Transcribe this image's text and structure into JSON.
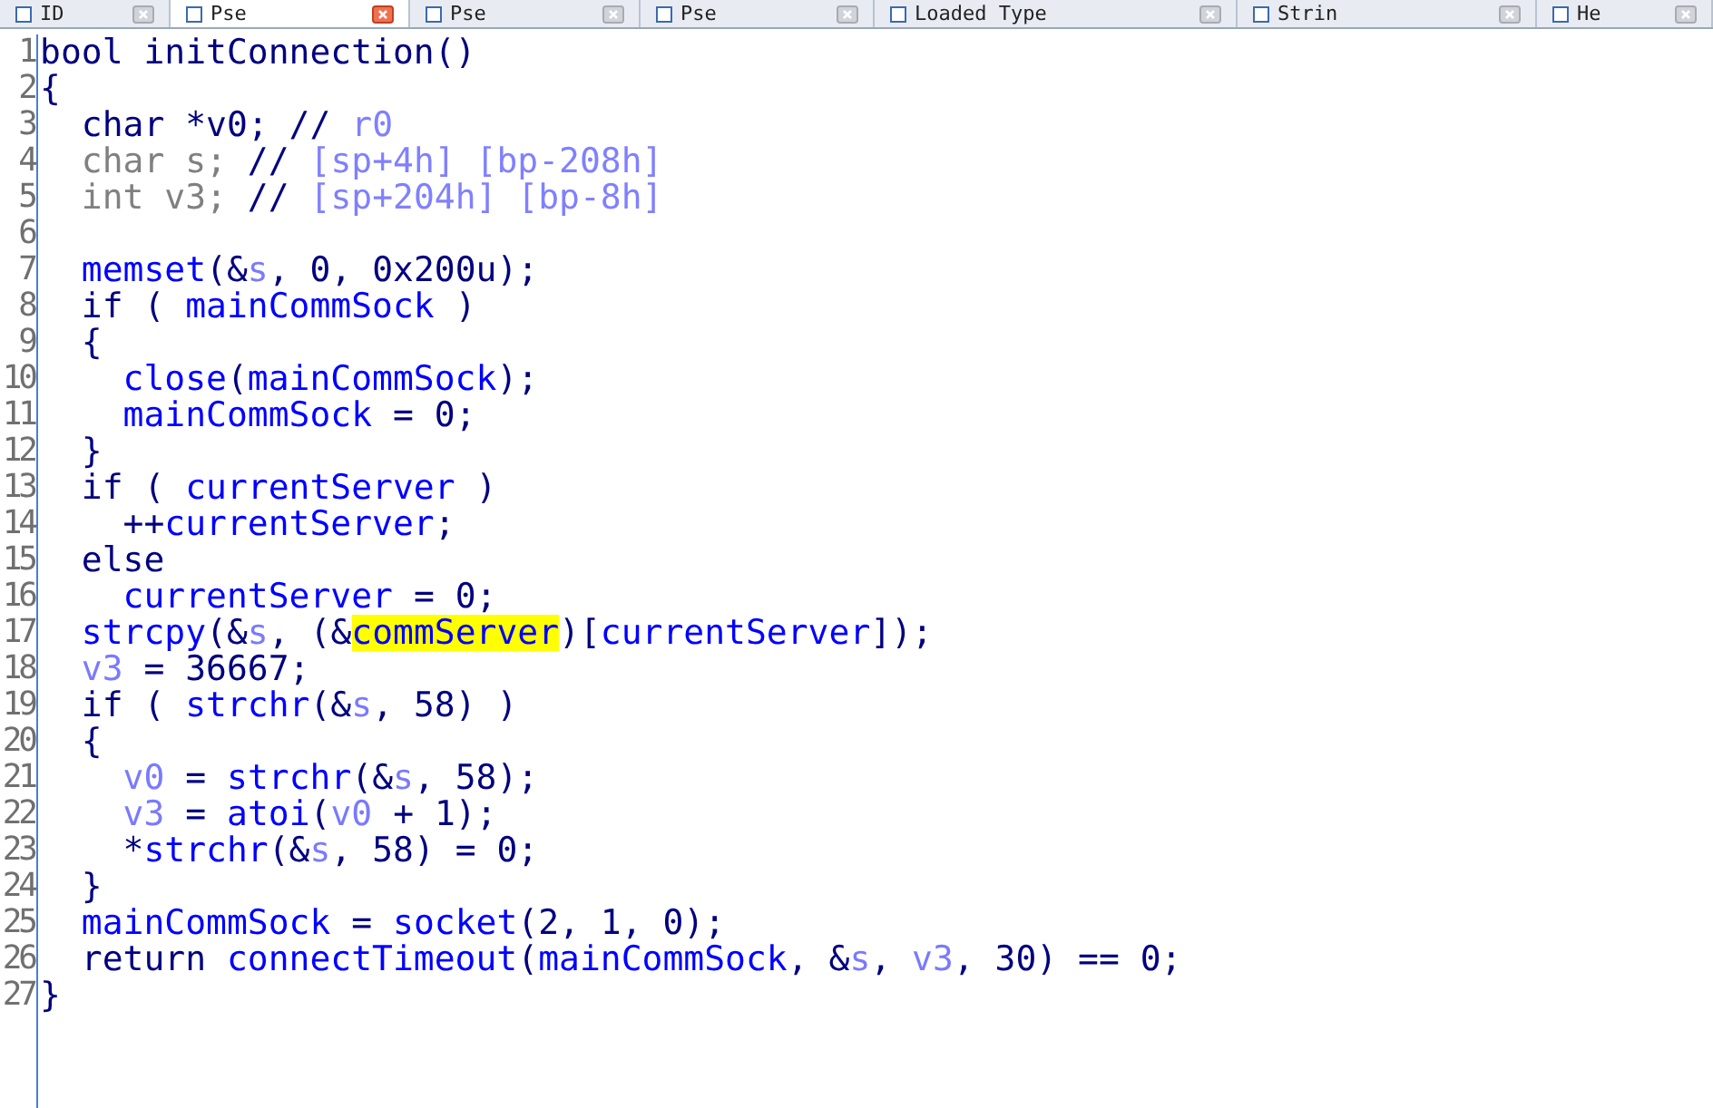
{
  "tabs": [
    {
      "label": "ID",
      "selected": false
    },
    {
      "label": "Pse",
      "selected": true
    },
    {
      "label": "Pse",
      "selected": false
    },
    {
      "label": "Pse",
      "selected": false
    },
    {
      "label": "Loaded Type",
      "selected": false
    },
    {
      "label": "Strin",
      "selected": false
    },
    {
      "label": "He",
      "selected": false
    }
  ],
  "code_lines": [
    {
      "number": "1",
      "tokens": [
        {
          "text": "bool initConnection()",
          "kind": "plain"
        }
      ]
    },
    {
      "number": "2",
      "tokens": [
        {
          "text": "{",
          "kind": "plain"
        }
      ]
    },
    {
      "number": "3",
      "tokens": [
        {
          "text": "  char *v0; //",
          "kind": "plain"
        },
        {
          "text": " r0",
          "kind": "comment"
        }
      ]
    },
    {
      "number": "4",
      "tokens": [
        {
          "text": "  char s; ",
          "kind": "disabled"
        },
        {
          "text": "//",
          "kind": "plain"
        },
        {
          "text": " [sp+4h] [bp-208h]",
          "kind": "comment"
        }
      ]
    },
    {
      "number": "5",
      "tokens": [
        {
          "text": "  int v3; ",
          "kind": "disabled"
        },
        {
          "text": "//",
          "kind": "plain"
        },
        {
          "text": " [sp+204h] [bp-8h]",
          "kind": "comment"
        }
      ]
    },
    {
      "number": "6"
    },
    {
      "number": "7",
      "tokens": [
        {
          "text": "  memset",
          "kind": "global"
        },
        {
          "text": "(&",
          "kind": "plain"
        },
        {
          "text": "s",
          "kind": "local"
        },
        {
          "text": ", 0, 0x200u);",
          "kind": "plain"
        }
      ]
    },
    {
      "number": "8",
      "tokens": [
        {
          "text": "  if ( ",
          "kind": "plain"
        },
        {
          "text": "mainCommSock",
          "kind": "global"
        },
        {
          "text": " )",
          "kind": "plain"
        }
      ]
    },
    {
      "number": "9",
      "tokens": [
        {
          "text": "  {",
          "kind": "plain"
        }
      ]
    },
    {
      "number": "10",
      "tokens": [
        {
          "text": "    close",
          "kind": "global"
        },
        {
          "text": "(",
          "kind": "plain"
        },
        {
          "text": "mainCommSock",
          "kind": "global"
        },
        {
          "text": ");",
          "kind": "plain"
        }
      ]
    },
    {
      "number": "11",
      "tokens": [
        {
          "text": "    mainCommSock",
          "kind": "global"
        },
        {
          "text": " = 0;",
          "kind": "plain"
        }
      ]
    },
    {
      "number": "12",
      "tokens": [
        {
          "text": "  }",
          "kind": "plain"
        }
      ]
    },
    {
      "number": "13",
      "tokens": [
        {
          "text": "  if ( ",
          "kind": "plain"
        },
        {
          "text": "currentServer",
          "kind": "global"
        },
        {
          "text": " )",
          "kind": "plain"
        }
      ]
    },
    {
      "number": "14",
      "tokens": [
        {
          "text": "    ++",
          "kind": "plain"
        },
        {
          "text": "currentServer",
          "kind": "global"
        },
        {
          "text": ";",
          "kind": "plain"
        }
      ]
    },
    {
      "number": "15",
      "tokens": [
        {
          "text": "  else",
          "kind": "plain"
        }
      ]
    },
    {
      "number": "16",
      "tokens": [
        {
          "text": "    currentServer",
          "kind": "global"
        },
        {
          "text": " = 0;",
          "kind": "plain"
        }
      ]
    },
    {
      "number": "17",
      "tokens": [
        {
          "text": "  strcpy",
          "kind": "global"
        },
        {
          "text": "(&",
          "kind": "plain"
        },
        {
          "text": "s",
          "kind": "local"
        },
        {
          "text": ", (&",
          "kind": "plain"
        },
        {
          "text": "commServer",
          "kind": "highlight"
        },
        {
          "text": ")[",
          "kind": "plain"
        },
        {
          "text": "currentServer",
          "kind": "global"
        },
        {
          "text": "]);",
          "kind": "plain"
        }
      ]
    },
    {
      "number": "18",
      "tokens": [
        {
          "text": "  v3",
          "kind": "local"
        },
        {
          "text": " = 36667;",
          "kind": "plain"
        }
      ]
    },
    {
      "number": "19",
      "tokens": [
        {
          "text": "  if ( ",
          "kind": "plain"
        },
        {
          "text": "strchr",
          "kind": "global"
        },
        {
          "text": "(&",
          "kind": "plain"
        },
        {
          "text": "s",
          "kind": "local"
        },
        {
          "text": ", 58) )",
          "kind": "plain"
        }
      ]
    },
    {
      "number": "20",
      "tokens": [
        {
          "text": "  {",
          "kind": "plain"
        }
      ]
    },
    {
      "number": "21",
      "tokens": [
        {
          "text": "    v0",
          "kind": "local"
        },
        {
          "text": " = ",
          "kind": "plain"
        },
        {
          "text": "strchr",
          "kind": "global"
        },
        {
          "text": "(&",
          "kind": "plain"
        },
        {
          "text": "s",
          "kind": "local"
        },
        {
          "text": ", 58);",
          "kind": "plain"
        }
      ]
    },
    {
      "number": "22",
      "tokens": [
        {
          "text": "    v3",
          "kind": "local"
        },
        {
          "text": " = ",
          "kind": "plain"
        },
        {
          "text": "atoi",
          "kind": "global"
        },
        {
          "text": "(",
          "kind": "plain"
        },
        {
          "text": "v0",
          "kind": "local"
        },
        {
          "text": " + 1);",
          "kind": "plain"
        }
      ]
    },
    {
      "number": "23",
      "tokens": [
        {
          "text": "    *",
          "kind": "plain"
        },
        {
          "text": "strchr",
          "kind": "global"
        },
        {
          "text": "(&",
          "kind": "plain"
        },
        {
          "text": "s",
          "kind": "local"
        },
        {
          "text": ", 58) = 0;",
          "kind": "plain"
        }
      ]
    },
    {
      "number": "24",
      "tokens": [
        {
          "text": "  }",
          "kind": "plain"
        }
      ]
    },
    {
      "number": "25",
      "tokens": [
        {
          "text": "  mainCommSock",
          "kind": "global"
        },
        {
          "text": " = ",
          "kind": "plain"
        },
        {
          "text": "socket",
          "kind": "global"
        },
        {
          "text": "(2, 1, 0);",
          "kind": "plain"
        }
      ]
    },
    {
      "number": "26",
      "tokens": [
        {
          "text": "  return ",
          "kind": "plain"
        },
        {
          "text": "connectTimeout",
          "kind": "global"
        },
        {
          "text": "(",
          "kind": "plain"
        },
        {
          "text": "mainCommSock",
          "kind": "global"
        },
        {
          "text": ", &",
          "kind": "plain"
        },
        {
          "text": "s",
          "kind": "local"
        },
        {
          "text": ", ",
          "kind": "plain"
        },
        {
          "text": "v3",
          "kind": "local"
        },
        {
          "text": ", 30) == 0;",
          "kind": "plain"
        }
      ]
    },
    {
      "number": "27",
      "tokens": [
        {
          "text": "}",
          "kind": "plain"
        }
      ]
    }
  ]
}
